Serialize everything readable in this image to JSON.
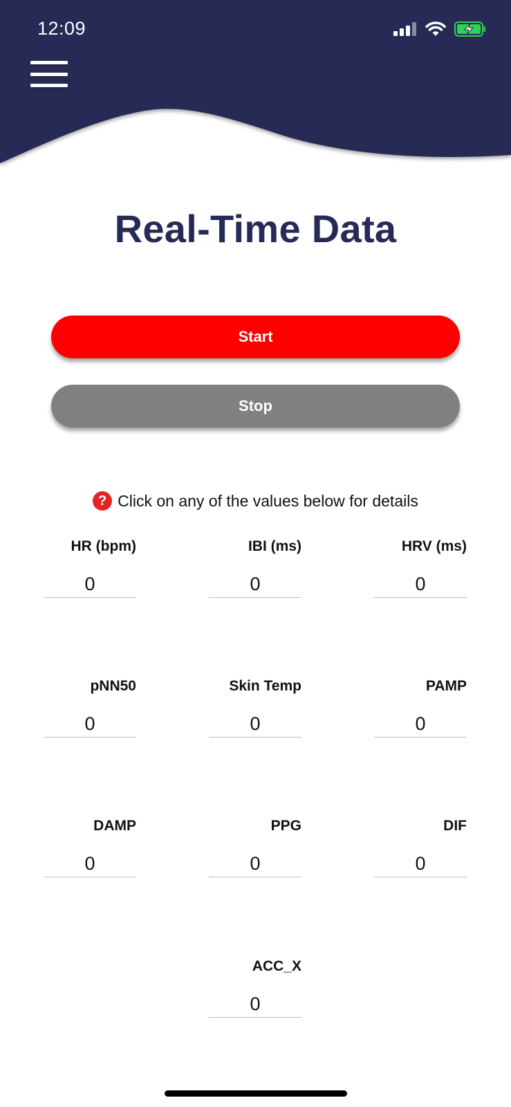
{
  "status_bar": {
    "time": "12:09",
    "icons": [
      "cellular-signal-icon",
      "wifi-icon",
      "battery-charging-icon"
    ]
  },
  "header": {
    "menu_icon": "hamburger-menu-icon",
    "background_color": "#272a55"
  },
  "title": "Real-Time Data",
  "buttons": {
    "start_label": "Start",
    "start_color": "#ff0000",
    "stop_label": "Stop",
    "stop_color": "#808080"
  },
  "hint": {
    "icon": "question-circle-icon",
    "text": "Click on any of the values below for details"
  },
  "metrics": [
    {
      "label": "HR (bpm)",
      "value": "0"
    },
    {
      "label": "IBI (ms)",
      "value": "0"
    },
    {
      "label": "HRV (ms)",
      "value": "0"
    },
    {
      "label": "pNN50",
      "value": "0"
    },
    {
      "label": "Skin Temp",
      "value": "0"
    },
    {
      "label": "PAMP",
      "value": "0"
    },
    {
      "label": "DAMP",
      "value": "0"
    },
    {
      "label": "PPG",
      "value": "0"
    },
    {
      "label": "DIF",
      "value": "0"
    },
    {
      "label": "ACC_X",
      "value": "0"
    }
  ]
}
